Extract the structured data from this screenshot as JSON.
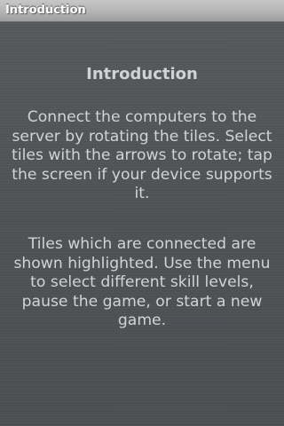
{
  "window": {
    "title": "Introduction"
  },
  "content": {
    "heading": "Introduction",
    "paragraphs": [
      "Connect the computers to the server by rotating the tiles. Select tiles with the arrows to rotate; tap the screen if your device supports it.",
      "Tiles which are connected are shown highlighted. Use the menu to select different skill levels, pause the game, or start a new game."
    ]
  }
}
